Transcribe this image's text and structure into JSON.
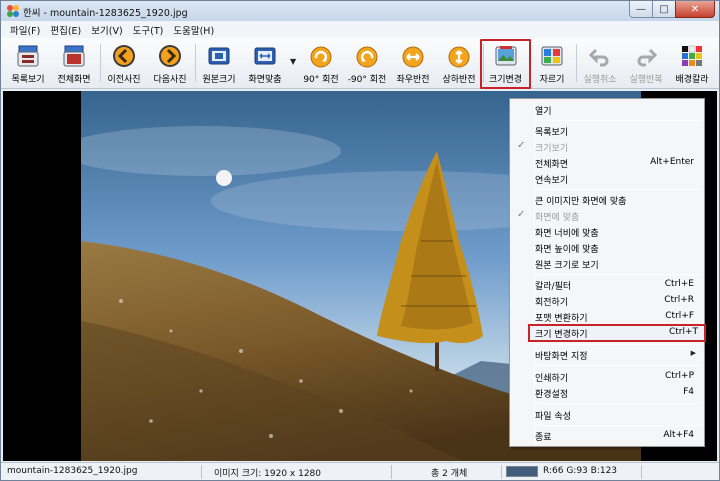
{
  "window": {
    "title": "한씨 - mountain-1283625_1920.jpg",
    "min_glyph": "—",
    "max_glyph": "□",
    "close_glyph": "✕"
  },
  "menubar": {
    "items": [
      "파일(F)",
      "편집(E)",
      "보기(V)",
      "도구(T)",
      "도움말(H)"
    ]
  },
  "toolbar": {
    "buttons": [
      {
        "label": "목록보기",
        "icon": "list-view-icon"
      },
      {
        "label": "전체화면",
        "icon": "fullscreen-icon"
      },
      {
        "label": "이전사진",
        "icon": "previous-icon"
      },
      {
        "label": "다음사진",
        "icon": "next-icon"
      },
      {
        "label": "원본크기",
        "icon": "original-size-icon"
      },
      {
        "label": "화면맞춤",
        "icon": "fit-screen-icon"
      },
      {
        "label": "90° 회전",
        "icon": "rotate-cw-icon"
      },
      {
        "label": "-90° 회전",
        "icon": "rotate-ccw-icon"
      },
      {
        "label": "좌우반전",
        "icon": "flip-horizontal-icon"
      },
      {
        "label": "상하반전",
        "icon": "flip-vertical-icon"
      },
      {
        "label": "크기변경",
        "icon": "resize-icon"
      },
      {
        "label": "자르기",
        "icon": "crop-icon"
      },
      {
        "label": "실행취소",
        "icon": "undo-icon"
      },
      {
        "label": "실행반복",
        "icon": "redo-icon"
      },
      {
        "label": "배경칼라",
        "icon": "background-color-icon"
      }
    ]
  },
  "context_menu": {
    "items": [
      {
        "label": "열기",
        "shortcut": ""
      },
      {
        "label": "목록보기",
        "shortcut": ""
      },
      {
        "label": "크기보기",
        "shortcut": ""
      },
      {
        "label": "전체화면",
        "shortcut": "Alt+Enter"
      },
      {
        "label": "연속보기",
        "shortcut": ""
      },
      {
        "label": "큰 이미지만 화면에 맞춤",
        "shortcut": ""
      },
      {
        "label": "화면에 맞춤",
        "shortcut": ""
      },
      {
        "label": "화면 너비에 맞춤",
        "shortcut": ""
      },
      {
        "label": "화면 높이에 맞춤",
        "shortcut": ""
      },
      {
        "label": "원본 크기로 보기",
        "shortcut": ""
      },
      {
        "label": "칼라/필터",
        "shortcut": "Ctrl+E"
      },
      {
        "label": "회전하기",
        "shortcut": "Ctrl+R"
      },
      {
        "label": "포맷 변환하기",
        "shortcut": "Ctrl+F"
      },
      {
        "label": "크기 변경하기",
        "shortcut": "Ctrl+T"
      },
      {
        "label": "바탕화면 지정",
        "shortcut": ""
      },
      {
        "label": "인쇄하기",
        "shortcut": "Ctrl+P"
      },
      {
        "label": "환경설정",
        "shortcut": "F4"
      },
      {
        "label": "파일 속성",
        "shortcut": ""
      },
      {
        "label": "종료",
        "shortcut": "Alt+F4"
      }
    ],
    "check_glyph": "✓",
    "submenu_glyph": "▶"
  },
  "statusbar": {
    "filename": "mountain-1283625_1920.jpg",
    "image_size": "이미지 크기: 1920 x 1280",
    "count": "총 2 개체",
    "rgb": "R:66 G:93 B:123",
    "swatch_color": "#425d7b"
  },
  "colors": {
    "highlight": "#c8232b",
    "sky": "#3e6a98",
    "hill": "#8a6a34"
  }
}
